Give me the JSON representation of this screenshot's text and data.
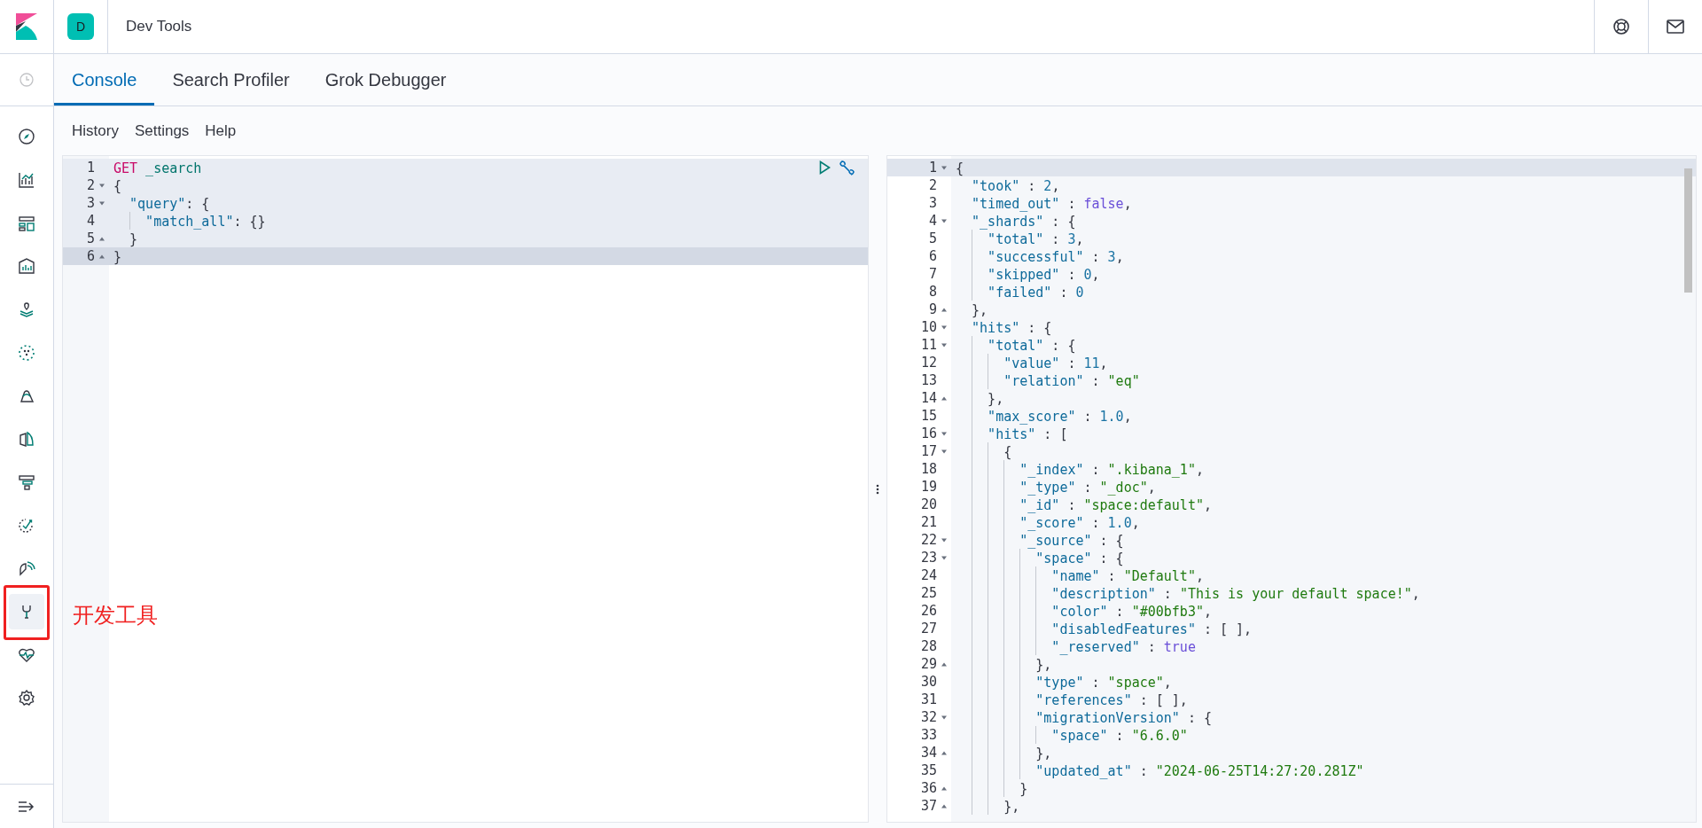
{
  "header": {
    "space_avatar": "D",
    "app_title": "Dev Tools"
  },
  "nav_items": [
    {
      "selected": false
    },
    {
      "selected": false
    },
    {
      "selected": false
    },
    {
      "selected": false
    },
    {
      "selected": false
    },
    {
      "selected": false
    },
    {
      "selected": false
    },
    {
      "selected": false
    },
    {
      "selected": false
    },
    {
      "selected": false
    },
    {
      "selected": false
    },
    {
      "selected": true
    },
    {
      "selected": false
    },
    {
      "selected": false
    }
  ],
  "annotation": {
    "label": "开发工具"
  },
  "tabs": [
    {
      "label": "Console",
      "selected": true
    },
    {
      "label": "Search Profiler",
      "selected": false
    },
    {
      "label": "Grok Debugger",
      "selected": false
    }
  ],
  "menu": [
    "History",
    "Settings",
    "Help"
  ],
  "request_editor": {
    "request_highlighted": true,
    "lines": [
      {
        "number": "1",
        "fold_start": false,
        "fold_end": false,
        "active": false,
        "tokens": [
          {
            "kind": "method",
            "text": "GET"
          },
          {
            "kind": "url",
            "text": " _search"
          }
        ]
      },
      {
        "number": "2",
        "fold_start": true,
        "fold_end": false,
        "active": false,
        "tokens": [
          {
            "kind": "punct",
            "text": "{"
          }
        ]
      },
      {
        "number": "3",
        "fold_start": true,
        "fold_end": false,
        "active": false,
        "tokens": [
          {
            "kind": "key",
            "text": "  \"query\""
          },
          {
            "kind": "punct",
            "text": ": {"
          }
        ]
      },
      {
        "number": "4",
        "fold_start": false,
        "fold_end": false,
        "active": false,
        "tokens": [
          {
            "kind": "key",
            "text": "    \"match_all\""
          },
          {
            "kind": "punct",
            "text": ": {}"
          }
        ]
      },
      {
        "number": "5",
        "fold_start": false,
        "fold_end": true,
        "active": false,
        "tokens": [
          {
            "kind": "punct",
            "text": "  }"
          }
        ]
      },
      {
        "number": "6",
        "fold_start": false,
        "fold_end": true,
        "active": true,
        "tokens": [
          {
            "kind": "punct",
            "text": "}"
          }
        ]
      }
    ]
  },
  "response_editor": {
    "lines": [
      {
        "number": "1",
        "fold_start": true,
        "fold_end": false,
        "active": true,
        "tokens": [
          {
            "kind": "punct",
            "text": "{"
          }
        ]
      },
      {
        "number": "2",
        "fold_start": false,
        "fold_end": false,
        "active": false,
        "tokens": [
          {
            "kind": "key",
            "text": "  \"took\""
          },
          {
            "kind": "punct",
            "text": " : "
          },
          {
            "kind": "number",
            "text": "2"
          },
          {
            "kind": "punct",
            "text": ","
          }
        ]
      },
      {
        "number": "3",
        "fold_start": false,
        "fold_end": false,
        "active": false,
        "tokens": [
          {
            "kind": "key",
            "text": "  \"timed_out\""
          },
          {
            "kind": "punct",
            "text": " : "
          },
          {
            "kind": "boolean",
            "text": "false"
          },
          {
            "kind": "punct",
            "text": ","
          }
        ]
      },
      {
        "number": "4",
        "fold_start": true,
        "fold_end": false,
        "active": false,
        "tokens": [
          {
            "kind": "key",
            "text": "  \"_shards\""
          },
          {
            "kind": "punct",
            "text": " : {"
          }
        ]
      },
      {
        "number": "5",
        "fold_start": false,
        "fold_end": false,
        "active": false,
        "tokens": [
          {
            "kind": "key",
            "text": "    \"total\""
          },
          {
            "kind": "punct",
            "text": " : "
          },
          {
            "kind": "number",
            "text": "3"
          },
          {
            "kind": "punct",
            "text": ","
          }
        ]
      },
      {
        "number": "6",
        "fold_start": false,
        "fold_end": false,
        "active": false,
        "tokens": [
          {
            "kind": "key",
            "text": "    \"successful\""
          },
          {
            "kind": "punct",
            "text": " : "
          },
          {
            "kind": "number",
            "text": "3"
          },
          {
            "kind": "punct",
            "text": ","
          }
        ]
      },
      {
        "number": "7",
        "fold_start": false,
        "fold_end": false,
        "active": false,
        "tokens": [
          {
            "kind": "key",
            "text": "    \"skipped\""
          },
          {
            "kind": "punct",
            "text": " : "
          },
          {
            "kind": "number",
            "text": "0"
          },
          {
            "kind": "punct",
            "text": ","
          }
        ]
      },
      {
        "number": "8",
        "fold_start": false,
        "fold_end": false,
        "active": false,
        "tokens": [
          {
            "kind": "key",
            "text": "    \"failed\""
          },
          {
            "kind": "punct",
            "text": " : "
          },
          {
            "kind": "number",
            "text": "0"
          }
        ]
      },
      {
        "number": "9",
        "fold_start": false,
        "fold_end": true,
        "active": false,
        "tokens": [
          {
            "kind": "punct",
            "text": "  },"
          }
        ]
      },
      {
        "number": "10",
        "fold_start": true,
        "fold_end": false,
        "active": false,
        "tokens": [
          {
            "kind": "key",
            "text": "  \"hits\""
          },
          {
            "kind": "punct",
            "text": " : {"
          }
        ]
      },
      {
        "number": "11",
        "fold_start": true,
        "fold_end": false,
        "active": false,
        "tokens": [
          {
            "kind": "key",
            "text": "    \"total\""
          },
          {
            "kind": "punct",
            "text": " : {"
          }
        ]
      },
      {
        "number": "12",
        "fold_start": false,
        "fold_end": false,
        "active": false,
        "tokens": [
          {
            "kind": "key",
            "text": "      \"value\""
          },
          {
            "kind": "punct",
            "text": " : "
          },
          {
            "kind": "number",
            "text": "11"
          },
          {
            "kind": "punct",
            "text": ","
          }
        ]
      },
      {
        "number": "13",
        "fold_start": false,
        "fold_end": false,
        "active": false,
        "tokens": [
          {
            "kind": "key",
            "text": "      \"relation\""
          },
          {
            "kind": "punct",
            "text": " : "
          },
          {
            "kind": "string",
            "text": "\"eq\""
          }
        ]
      },
      {
        "number": "14",
        "fold_start": false,
        "fold_end": true,
        "active": false,
        "tokens": [
          {
            "kind": "punct",
            "text": "    },"
          }
        ]
      },
      {
        "number": "15",
        "fold_start": false,
        "fold_end": false,
        "active": false,
        "tokens": [
          {
            "kind": "key",
            "text": "    \"max_score\""
          },
          {
            "kind": "punct",
            "text": " : "
          },
          {
            "kind": "number",
            "text": "1.0"
          },
          {
            "kind": "punct",
            "text": ","
          }
        ]
      },
      {
        "number": "16",
        "fold_start": true,
        "fold_end": false,
        "active": false,
        "tokens": [
          {
            "kind": "key",
            "text": "    \"hits\""
          },
          {
            "kind": "punct",
            "text": " : ["
          }
        ]
      },
      {
        "number": "17",
        "fold_start": true,
        "fold_end": false,
        "active": false,
        "tokens": [
          {
            "kind": "punct",
            "text": "      {"
          }
        ]
      },
      {
        "number": "18",
        "fold_start": false,
        "fold_end": false,
        "active": false,
        "tokens": [
          {
            "kind": "key",
            "text": "        \"_index\""
          },
          {
            "kind": "punct",
            "text": " : "
          },
          {
            "kind": "string",
            "text": "\".kibana_1\""
          },
          {
            "kind": "punct",
            "text": ","
          }
        ]
      },
      {
        "number": "19",
        "fold_start": false,
        "fold_end": false,
        "active": false,
        "tokens": [
          {
            "kind": "key",
            "text": "        \"_type\""
          },
          {
            "kind": "punct",
            "text": " : "
          },
          {
            "kind": "string",
            "text": "\"_doc\""
          },
          {
            "kind": "punct",
            "text": ","
          }
        ]
      },
      {
        "number": "20",
        "fold_start": false,
        "fold_end": false,
        "active": false,
        "tokens": [
          {
            "kind": "key",
            "text": "        \"_id\""
          },
          {
            "kind": "punct",
            "text": " : "
          },
          {
            "kind": "string",
            "text": "\"space:default\""
          },
          {
            "kind": "punct",
            "text": ","
          }
        ]
      },
      {
        "number": "21",
        "fold_start": false,
        "fold_end": false,
        "active": false,
        "tokens": [
          {
            "kind": "key",
            "text": "        \"_score\""
          },
          {
            "kind": "punct",
            "text": " : "
          },
          {
            "kind": "number",
            "text": "1.0"
          },
          {
            "kind": "punct",
            "text": ","
          }
        ]
      },
      {
        "number": "22",
        "fold_start": true,
        "fold_end": false,
        "active": false,
        "tokens": [
          {
            "kind": "key",
            "text": "        \"_source\""
          },
          {
            "kind": "punct",
            "text": " : {"
          }
        ]
      },
      {
        "number": "23",
        "fold_start": true,
        "fold_end": false,
        "active": false,
        "tokens": [
          {
            "kind": "key",
            "text": "          \"space\""
          },
          {
            "kind": "punct",
            "text": " : {"
          }
        ]
      },
      {
        "number": "24",
        "fold_start": false,
        "fold_end": false,
        "active": false,
        "tokens": [
          {
            "kind": "key",
            "text": "            \"name\""
          },
          {
            "kind": "punct",
            "text": " : "
          },
          {
            "kind": "string",
            "text": "\"Default\""
          },
          {
            "kind": "punct",
            "text": ","
          }
        ]
      },
      {
        "number": "25",
        "fold_start": false,
        "fold_end": false,
        "active": false,
        "tokens": [
          {
            "kind": "key",
            "text": "            \"description\""
          },
          {
            "kind": "punct",
            "text": " : "
          },
          {
            "kind": "string",
            "text": "\"This is your default space!\""
          },
          {
            "kind": "punct",
            "text": ","
          }
        ]
      },
      {
        "number": "26",
        "fold_start": false,
        "fold_end": false,
        "active": false,
        "tokens": [
          {
            "kind": "key",
            "text": "            \"color\""
          },
          {
            "kind": "punct",
            "text": " : "
          },
          {
            "kind": "string",
            "text": "\"#00bfb3\""
          },
          {
            "kind": "punct",
            "text": ","
          }
        ]
      },
      {
        "number": "27",
        "fold_start": false,
        "fold_end": false,
        "active": false,
        "tokens": [
          {
            "kind": "key",
            "text": "            \"disabledFeatures\""
          },
          {
            "kind": "punct",
            "text": " : [ ],"
          }
        ]
      },
      {
        "number": "28",
        "fold_start": false,
        "fold_end": false,
        "active": false,
        "tokens": [
          {
            "kind": "key",
            "text": "            \"_reserved\""
          },
          {
            "kind": "punct",
            "text": " : "
          },
          {
            "kind": "boolean",
            "text": "true"
          }
        ]
      },
      {
        "number": "29",
        "fold_start": false,
        "fold_end": true,
        "active": false,
        "tokens": [
          {
            "kind": "punct",
            "text": "          },"
          }
        ]
      },
      {
        "number": "30",
        "fold_start": false,
        "fold_end": false,
        "active": false,
        "tokens": [
          {
            "kind": "key",
            "text": "          \"type\""
          },
          {
            "kind": "punct",
            "text": " : "
          },
          {
            "kind": "string",
            "text": "\"space\""
          },
          {
            "kind": "punct",
            "text": ","
          }
        ]
      },
      {
        "number": "31",
        "fold_start": false,
        "fold_end": false,
        "active": false,
        "tokens": [
          {
            "kind": "key",
            "text": "          \"references\""
          },
          {
            "kind": "punct",
            "text": " : [ ],"
          }
        ]
      },
      {
        "number": "32",
        "fold_start": true,
        "fold_end": false,
        "active": false,
        "tokens": [
          {
            "kind": "key",
            "text": "          \"migrationVersion\""
          },
          {
            "kind": "punct",
            "text": " : {"
          }
        ]
      },
      {
        "number": "33",
        "fold_start": false,
        "fold_end": false,
        "active": false,
        "tokens": [
          {
            "kind": "key",
            "text": "            \"space\""
          },
          {
            "kind": "punct",
            "text": " : "
          },
          {
            "kind": "string",
            "text": "\"6.6.0\""
          }
        ]
      },
      {
        "number": "34",
        "fold_start": false,
        "fold_end": true,
        "active": false,
        "tokens": [
          {
            "kind": "punct",
            "text": "          },"
          }
        ]
      },
      {
        "number": "35",
        "fold_start": false,
        "fold_end": false,
        "active": false,
        "tokens": [
          {
            "kind": "key",
            "text": "          \"updated_at\""
          },
          {
            "kind": "punct",
            "text": " : "
          },
          {
            "kind": "string",
            "text": "\"2024-06-25T14:27:20.281Z\""
          }
        ]
      },
      {
        "number": "36",
        "fold_start": false,
        "fold_end": true,
        "active": false,
        "tokens": [
          {
            "kind": "punct",
            "text": "        }"
          }
        ]
      },
      {
        "number": "37",
        "fold_start": false,
        "fold_end": true,
        "active": false,
        "tokens": [
          {
            "kind": "punct",
            "text": "      },"
          }
        ]
      }
    ]
  }
}
